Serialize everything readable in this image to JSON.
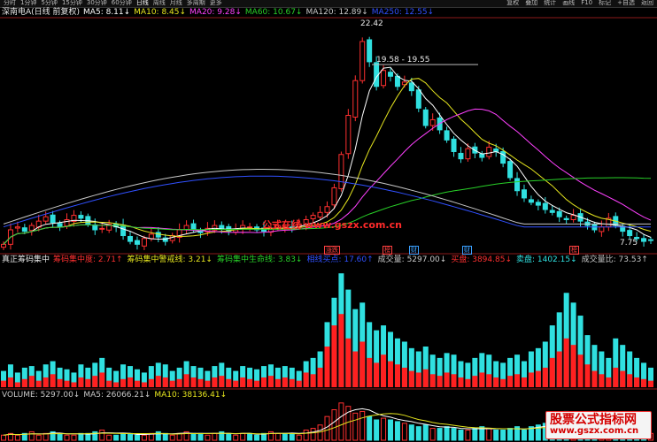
{
  "toolbar": {
    "periods": [
      "分时",
      "1分钟",
      "5分钟",
      "15分钟",
      "30分钟",
      "60分钟",
      "日线",
      "周线",
      "月线",
      "多周期",
      "更多"
    ],
    "active": "日线",
    "right": [
      "复权",
      "叠加",
      "统计",
      "画线",
      "F10",
      "标记",
      "+自选",
      "返回"
    ]
  },
  "main_legend": {
    "title": "深南电A(日线 前复权)",
    "items": [
      {
        "text": "MA5: 8.11↓",
        "color": "#ffffff"
      },
      {
        "text": "MA10: 8.45↓",
        "color": "#e5e51e"
      },
      {
        "text": "MA20: 9.28↓",
        "color": "#ff40ff"
      },
      {
        "text": "MA60: 10.67↓",
        "color": "#28d028"
      },
      {
        "text": "MA120: 12.89↓",
        "color": "#c8c8c8"
      },
      {
        "text": "MA250: 12.55↓",
        "color": "#3050ff"
      }
    ]
  },
  "annotations": {
    "high": "22.42",
    "low": "7.75",
    "range": "19.58 - 19.55"
  },
  "watermark": "公式在线 www.gszx.com.cn",
  "event_marks": [
    {
      "text": "涨跌",
      "color": "#ff4040"
    },
    {
      "text": "榜",
      "color": "#ff4040"
    },
    {
      "text": "财",
      "color": "#3aa0ff"
    },
    {
      "text": "财",
      "color": "#3aa0ff"
    },
    {
      "text": "榜",
      "color": "#ff4040"
    }
  ],
  "indicator_legend": {
    "title": "真正筹码集中",
    "items": [
      {
        "text": "筹码集中度: 2.71↑",
        "color": "#ff3030"
      },
      {
        "text": "筹码集中警戒线: 3.21↓",
        "color": "#e5e51e"
      },
      {
        "text": "筹码集中生命线: 3.83↓",
        "color": "#28d028"
      },
      {
        "text": "相线买点: 17.60↑",
        "color": "#3050ff"
      },
      {
        "text": "成交量: 5297.00↓",
        "color": "#c8c8c8"
      },
      {
        "text": "买盘: 3894.85↓",
        "color": "#ff3030"
      },
      {
        "text": "卖盘: 1402.15↓",
        "color": "#30e0e0"
      },
      {
        "text": "成交量比: 73.53↑",
        "color": "#c8c8c8"
      }
    ]
  },
  "volume_legend": {
    "items": [
      {
        "text": "VOLUME: 5297.00↓",
        "color": "#c8c8c8"
      },
      {
        "text": "MA5: 26066.21↓",
        "color": "#c8c8c8"
      },
      {
        "text": "MA10: 38136.41↓",
        "color": "#e5e51e"
      }
    ]
  },
  "brand": {
    "line1": "股票公式指标网",
    "line2": "www.gszx.com.cn"
  },
  "colors": {
    "up": "#ff3030",
    "down": "#30e0e0",
    "bg": "#000000"
  },
  "chart_data": [
    {
      "type": "candlestick",
      "title": "深南电A(日线 前复权)",
      "price_range": [
        7.5,
        23.0
      ],
      "close": [
        7.6,
        8.6,
        8.8,
        8.5,
        8.9,
        9.2,
        9.5,
        9.1,
        8.8,
        9.3,
        9.6,
        9.4,
        9.0,
        8.6,
        8.7,
        9.0,
        8.8,
        8.2,
        7.8,
        7.6,
        8.0,
        8.3,
        8.1,
        7.8,
        8.2,
        8.6,
        8.9,
        8.6,
        8.4,
        8.7,
        8.9,
        8.7,
        8.5,
        8.6,
        8.9,
        8.8,
        8.6,
        8.5,
        8.7,
        8.9,
        8.8,
        8.7,
        9.0,
        9.3,
        9.6,
        9.8,
        10.2,
        11.5,
        13.8,
        16.5,
        18.9,
        21.6,
        20.2,
        18.5,
        19.6,
        19.2,
        18.5,
        18.8,
        18.2,
        17.0,
        15.8,
        16.2,
        15.5,
        14.8,
        14.0,
        13.5,
        14.2,
        13.9,
        13.6,
        14.3,
        14.0,
        13.2,
        12.2,
        11.3,
        10.8,
        10.5,
        10.3,
        10.0,
        9.8,
        9.5,
        9.3,
        9.6,
        9.2,
        8.9,
        8.6,
        8.8,
        9.4,
        8.9,
        8.5,
        8.2,
        8.0,
        7.8,
        7.9
      ],
      "ma_series": [
        "MA5",
        "MA10",
        "MA20",
        "MA60",
        "MA120",
        "MA250"
      ]
    },
    {
      "type": "bar",
      "title": "真正筹码集中",
      "series": [
        {
          "name": "买盘",
          "values": [
            4,
            6,
            3,
            5,
            7,
            4,
            6,
            8,
            5,
            4,
            3,
            6,
            5,
            7,
            9,
            4,
            3,
            5,
            6,
            4,
            3,
            5,
            7,
            6,
            4,
            5,
            8,
            6,
            5,
            4,
            6,
            7,
            5,
            4,
            6,
            5,
            4,
            6,
            7,
            5,
            6,
            5,
            4,
            9,
            8,
            12,
            25,
            38,
            45,
            30,
            22,
            28,
            18,
            15,
            20,
            16,
            14,
            12,
            10,
            9,
            11,
            8,
            7,
            9,
            8,
            6,
            5,
            7,
            9,
            8,
            6,
            5,
            7,
            8,
            6,
            9,
            10,
            12,
            18,
            22,
            30,
            26,
            20,
            14,
            10,
            8,
            6,
            12,
            10,
            8,
            6,
            5,
            4
          ]
        },
        {
          "name": "卖盘",
          "values": [
            10,
            14,
            9,
            12,
            13,
            10,
            14,
            16,
            12,
            11,
            9,
            14,
            12,
            15,
            18,
            12,
            10,
            14,
            13,
            11,
            9,
            13,
            15,
            14,
            10,
            12,
            16,
            13,
            12,
            10,
            13,
            15,
            12,
            10,
            13,
            12,
            11,
            13,
            14,
            12,
            13,
            12,
            10,
            16,
            18,
            22,
            40,
            55,
            70,
            60,
            48,
            52,
            40,
            35,
            38,
            34,
            30,
            28,
            24,
            22,
            25,
            20,
            18,
            21,
            20,
            16,
            15,
            18,
            21,
            20,
            16,
            15,
            18,
            20,
            16,
            22,
            24,
            28,
            38,
            46,
            58,
            52,
            44,
            32,
            26,
            22,
            18,
            30,
            26,
            22,
            18,
            15,
            12
          ]
        }
      ]
    },
    {
      "type": "bar",
      "title": "VOLUME",
      "values": [
        3,
        4,
        3,
        4,
        5,
        3,
        4,
        5,
        4,
        3,
        3,
        4,
        4,
        5,
        6,
        3,
        3,
        4,
        4,
        3,
        3,
        4,
        5,
        4,
        3,
        4,
        5,
        4,
        4,
        3,
        4,
        5,
        4,
        3,
        4,
        4,
        3,
        4,
        5,
        4,
        4,
        4,
        3,
        6,
        7,
        9,
        14,
        18,
        22,
        20,
        16,
        17,
        14,
        12,
        13,
        12,
        11,
        10,
        9,
        8,
        9,
        7,
        7,
        8,
        7,
        6,
        6,
        7,
        8,
        7,
        6,
        6,
        7,
        8,
        6,
        8,
        9,
        10,
        13,
        15,
        17,
        15,
        13,
        10,
        9,
        8,
        7,
        9,
        8,
        7,
        6,
        5,
        4
      ]
    }
  ]
}
